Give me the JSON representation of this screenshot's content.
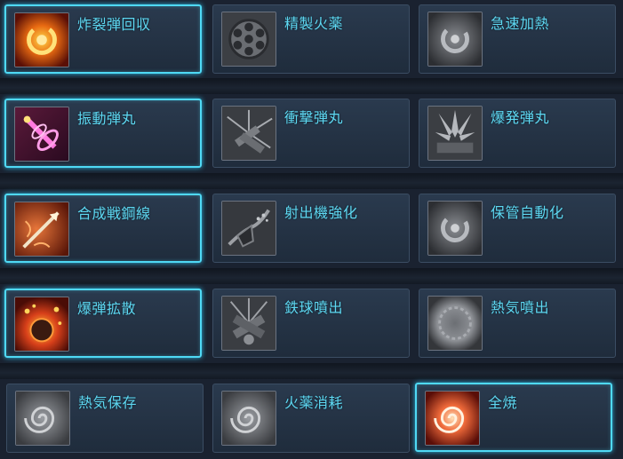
{
  "skills": [
    [
      {
        "name": "炸裂弾回収",
        "active": true,
        "icon": "explosion-orb-icon"
      },
      {
        "name": "精製火薬",
        "active": false,
        "icon": "cylinder-icon"
      },
      {
        "name": "急速加熱",
        "active": false,
        "icon": "swirl-icon"
      }
    ],
    [
      {
        "name": "振動弾丸",
        "active": true,
        "icon": "vibrating-bullet-icon"
      },
      {
        "name": "衝撃弾丸",
        "active": false,
        "icon": "impact-bullets-icon"
      },
      {
        "name": "爆発弾丸",
        "active": false,
        "icon": "burst-icon"
      }
    ],
    [
      {
        "name": "合成戦鋼線",
        "active": true,
        "icon": "steel-arrow-icon"
      },
      {
        "name": "射出機強化",
        "active": false,
        "icon": "launcher-icon"
      },
      {
        "name": "保管自動化",
        "active": false,
        "icon": "swirl-icon"
      }
    ],
    [
      {
        "name": "爆弾拡散",
        "active": true,
        "icon": "bomb-scatter-icon"
      },
      {
        "name": "鉄球噴出",
        "active": false,
        "icon": "iron-ball-icon"
      },
      {
        "name": "熱気噴出",
        "active": false,
        "icon": "heat-burst-icon"
      }
    ],
    [
      {
        "name": "熱気保存",
        "active": false,
        "icon": "vortex-icon"
      },
      {
        "name": "火薬消耗",
        "active": false,
        "icon": "vortex-icon"
      },
      {
        "name": "全焼",
        "active": true,
        "icon": "fire-vortex-icon"
      }
    ]
  ]
}
